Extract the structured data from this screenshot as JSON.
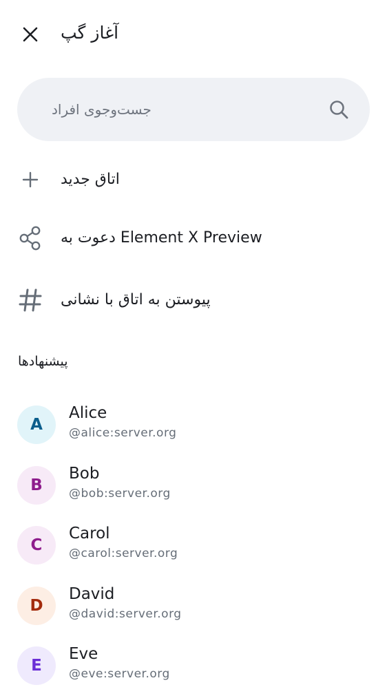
{
  "header": {
    "title": "آغاز گپ",
    "close_icon": "close-icon"
  },
  "search": {
    "placeholder": "جست‌وجوی افراد",
    "icon": "search-icon"
  },
  "actions": [
    {
      "label": "اتاق جدید",
      "icon": "plus-icon"
    },
    {
      "label": "دعوت به Element X Preview",
      "icon": "share-icon"
    },
    {
      "label": "پیوستن به اتاق با نشانی",
      "icon": "hash-icon"
    }
  ],
  "suggestions": {
    "header": "پیشنهادها",
    "users": [
      {
        "initial": "A",
        "name": "Alice",
        "id": "@alice:server.org",
        "avatar_bg": "#e1f4f9",
        "avatar_fg": "#0b5e8c"
      },
      {
        "initial": "B",
        "name": "Bob",
        "id": "@bob:server.org",
        "avatar_bg": "#f7eaf7",
        "avatar_fg": "#8e1d8c"
      },
      {
        "initial": "C",
        "name": "Carol",
        "id": "@carol:server.org",
        "avatar_bg": "#f7eaf7",
        "avatar_fg": "#8e1d8c"
      },
      {
        "initial": "D",
        "name": "David",
        "id": "@david:server.org",
        "avatar_bg": "#fdeee4",
        "avatar_fg": "#a32b0d"
      },
      {
        "initial": "E",
        "name": "Eve",
        "id": "@eve:server.org",
        "avatar_bg": "#efeafd",
        "avatar_fg": "#6b2fd6"
      }
    ]
  }
}
